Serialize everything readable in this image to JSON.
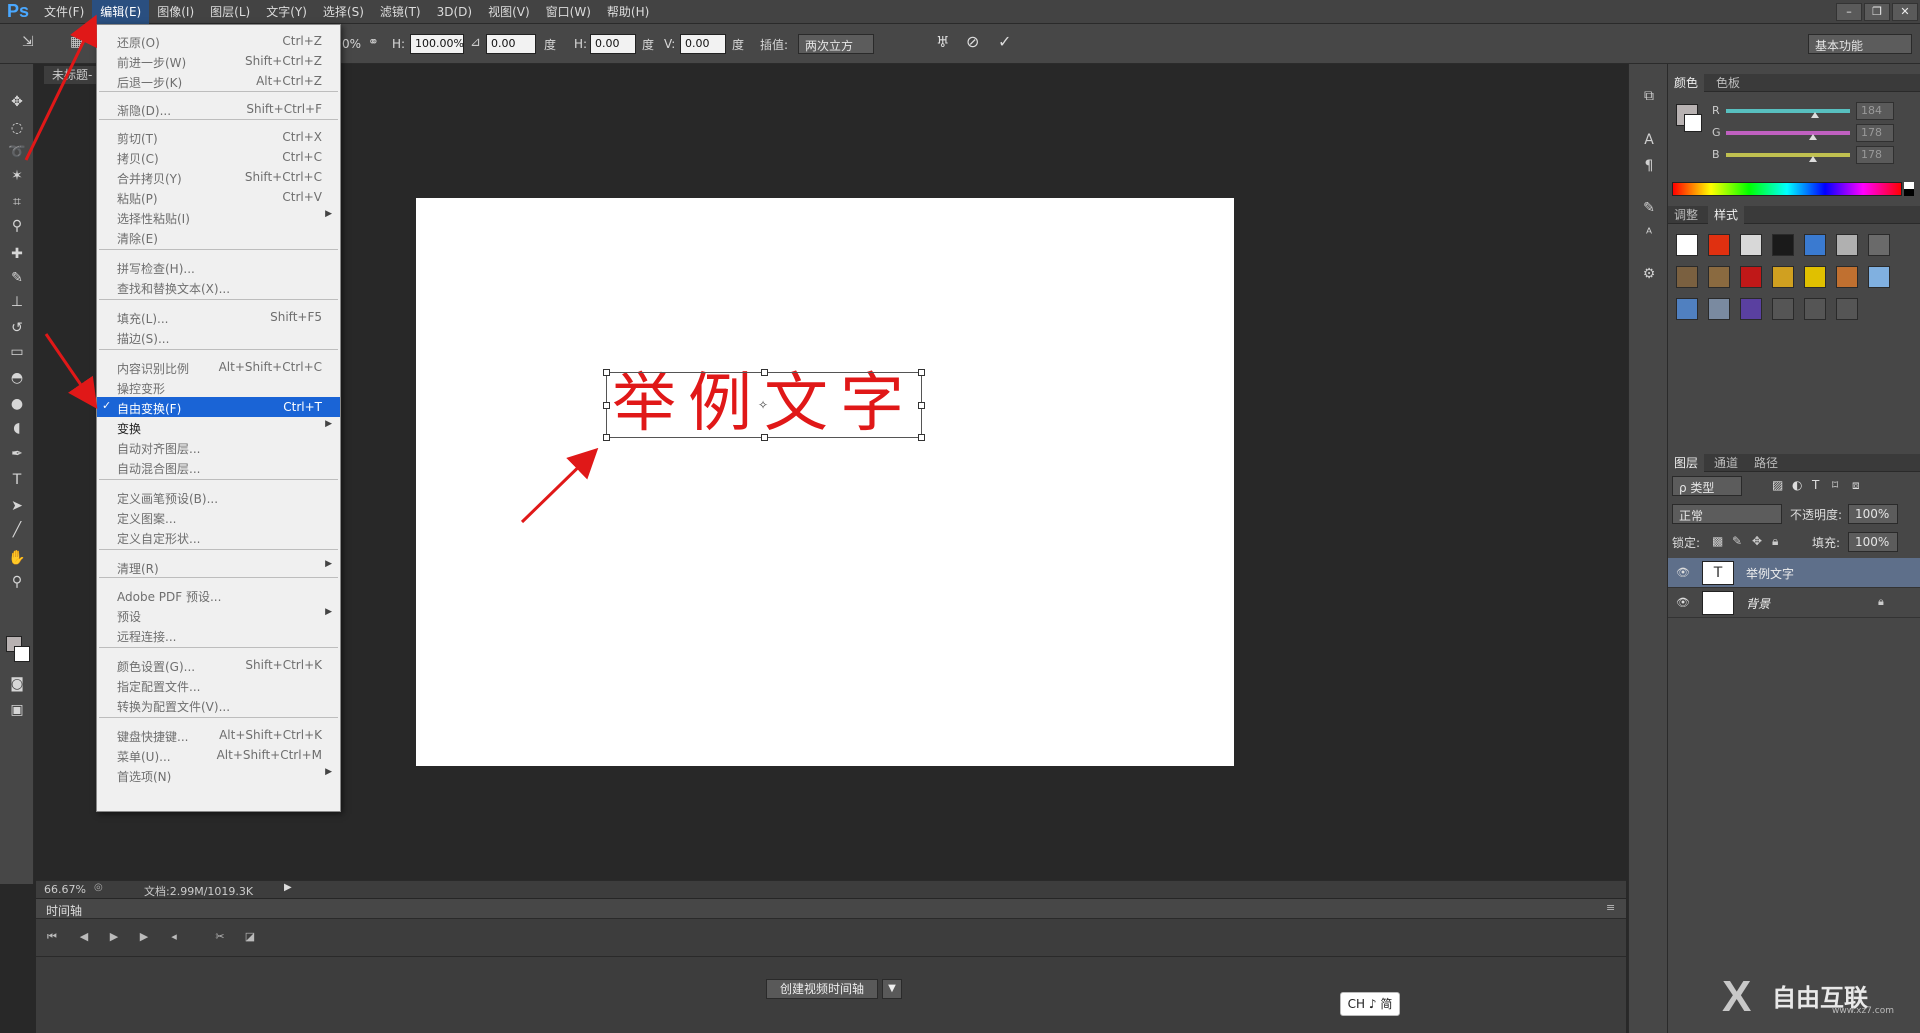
{
  "app": {
    "logo": "Ps"
  },
  "menubar": {
    "items": [
      "文件(F)",
      "编辑(E)",
      "图像(I)",
      "图层(L)",
      "文字(Y)",
      "选择(S)",
      "滤镜(T)",
      "3D(D)",
      "视图(V)",
      "窗口(W)",
      "帮助(H)"
    ],
    "active": "编辑(E)"
  },
  "window_controls": {
    "minimize": "–",
    "restore": "❐",
    "close": "✕"
  },
  "options": {
    "w_pct": "0%",
    "h_label": "H:",
    "h_pct": "100.00%",
    "angle": "0.00",
    "deg": "度",
    "hskew_label": "H:",
    "hskew": "0.00",
    "vskew_label": "V:",
    "vskew": "0.00",
    "interp_label": "插值:",
    "interp_value": "两次立方",
    "workspace": "基本功能"
  },
  "document": {
    "tab": "未标题-",
    "sample_text": "举例文字"
  },
  "status": {
    "zoom": "66.67%",
    "doc_info": "文档:2.99M/1019.3K"
  },
  "timeline": {
    "title": "时间轴",
    "create_button": "创建视频时间轴"
  },
  "ime": {
    "label": "CH ♪ 简"
  },
  "color_panel": {
    "tabs": [
      "颜色",
      "色板"
    ],
    "channels": [
      {
        "name": "R",
        "value": "184",
        "level": 0.72,
        "color": "#58c0c0"
      },
      {
        "name": "G",
        "value": "178",
        "level": 0.7,
        "color": "#c060c0"
      },
      {
        "name": "B",
        "value": "178",
        "level": 0.7,
        "color": "#c0c050"
      }
    ]
  },
  "style_panel": {
    "tabs": [
      "调整",
      "样式"
    ]
  },
  "layers_panel": {
    "tabs": [
      "图层",
      "通道",
      "路径"
    ],
    "filter": "ρ 类型",
    "blend": "正常",
    "opacity_label": "不透明度:",
    "opacity": "100%",
    "lock_label": "锁定:",
    "fill_label": "填充:",
    "fill": "100%",
    "layers": [
      {
        "name": "举例文字",
        "thumb": "T",
        "selected": true
      },
      {
        "name": "背景",
        "thumb": "",
        "selected": false
      }
    ]
  },
  "edit_menu": {
    "items": [
      {
        "label": "还原(O)",
        "shortcut": "Ctrl+Z"
      },
      {
        "label": "前进一步(W)",
        "shortcut": "Shift+Ctrl+Z"
      },
      {
        "label": "后退一步(K)",
        "shortcut": "Alt+Ctrl+Z"
      },
      {
        "label": "渐隐(D)...",
        "shortcut": "Shift+Ctrl+F"
      },
      {
        "label": "剪切(T)",
        "shortcut": "Ctrl+X"
      },
      {
        "label": "拷贝(C)",
        "shortcut": "Ctrl+C"
      },
      {
        "label": "合并拷贝(Y)",
        "shortcut": "Shift+Ctrl+C"
      },
      {
        "label": "粘贴(P)",
        "shortcut": "Ctrl+V"
      },
      {
        "label": "选择性粘贴(I)",
        "shortcut": ""
      },
      {
        "label": "清除(E)",
        "shortcut": ""
      },
      {
        "label": "拼写检查(H)...",
        "shortcut": ""
      },
      {
        "label": "查找和替换文本(X)...",
        "shortcut": ""
      },
      {
        "label": "填充(L)...",
        "shortcut": "Shift+F5"
      },
      {
        "label": "描边(S)...",
        "shortcut": ""
      },
      {
        "label": "内容识别比例",
        "shortcut": "Alt+Shift+Ctrl+C"
      },
      {
        "label": "操控变形",
        "shortcut": ""
      },
      {
        "label": "自由变换(F)",
        "shortcut": "Ctrl+T"
      },
      {
        "label": "变换",
        "shortcut": ""
      },
      {
        "label": "自动对齐图层...",
        "shortcut": ""
      },
      {
        "label": "自动混合图层...",
        "shortcut": ""
      },
      {
        "label": "定义画笔预设(B)...",
        "shortcut": ""
      },
      {
        "label": "定义图案...",
        "shortcut": ""
      },
      {
        "label": "定义自定形状...",
        "shortcut": ""
      },
      {
        "label": "清理(R)",
        "shortcut": ""
      },
      {
        "label": "Adobe PDF 预设...",
        "shortcut": ""
      },
      {
        "label": "预设",
        "shortcut": ""
      },
      {
        "label": "远程连接...",
        "shortcut": ""
      },
      {
        "label": "颜色设置(G)...",
        "shortcut": "Shift+Ctrl+K"
      },
      {
        "label": "指定配置文件...",
        "shortcut": ""
      },
      {
        "label": "转换为配置文件(V)...",
        "shortcut": ""
      },
      {
        "label": "键盘快捷键...",
        "shortcut": "Alt+Shift+Ctrl+K"
      },
      {
        "label": "菜单(U)...",
        "shortcut": "Alt+Shift+Ctrl+M"
      },
      {
        "label": "首选项(N)",
        "shortcut": ""
      }
    ]
  },
  "watermark": {
    "text": "自由互联",
    "url": "www.xz7.com"
  }
}
